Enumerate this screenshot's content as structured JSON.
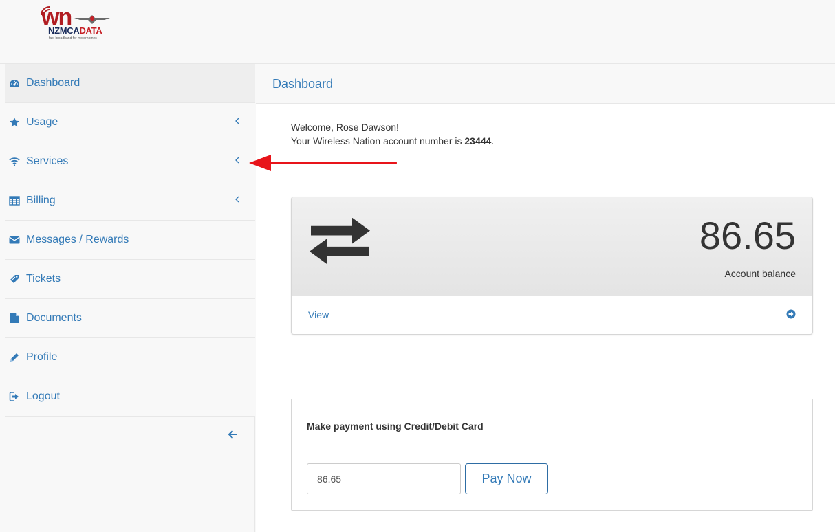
{
  "header": {
    "logo": {
      "mark": "wn",
      "brand_part1": "NZMCA",
      "brand_part2": "DATA",
      "tagline": "fast broadband for motorhomes"
    }
  },
  "sidebar": {
    "items": [
      {
        "label": "Dashboard",
        "icon": "dashboard-icon",
        "active": true,
        "has_submenu": false
      },
      {
        "label": "Usage",
        "icon": "star-icon",
        "has_submenu": true
      },
      {
        "label": "Services",
        "icon": "wifi-icon",
        "has_submenu": true
      },
      {
        "label": "Billing",
        "icon": "calculator-icon",
        "has_submenu": true
      },
      {
        "label": "Messages / Rewards",
        "icon": "envelope-icon",
        "has_submenu": false
      },
      {
        "label": "Tickets",
        "icon": "tag-icon",
        "has_submenu": false
      },
      {
        "label": "Documents",
        "icon": "file-icon",
        "has_submenu": false
      },
      {
        "label": "Profile",
        "icon": "pencil-icon",
        "has_submenu": false
      },
      {
        "label": "Logout",
        "icon": "logout-icon",
        "has_submenu": false
      }
    ],
    "collapse_icon": "arrow-left-icon"
  },
  "main": {
    "page_title": "Dashboard",
    "welcome": {
      "greeting": "Welcome, Rose Dawson!",
      "account_prefix": "Your Wireless Nation account number is ",
      "account_number": "23444",
      "account_suffix": "."
    },
    "balance_panel": {
      "icon": "exchange-icon",
      "value": "86.65",
      "label": "Account balance",
      "link_label": "View",
      "link_icon": "arrow-circle-right-icon"
    },
    "payment_panel": {
      "title": "Make payment using Credit/Debit Card",
      "amount_value": "86.65",
      "button_label": "Pay Now"
    }
  },
  "colors": {
    "link": "#337ab7",
    "annotation_arrow": "#e8141a",
    "logo_red": "#c62026",
    "logo_navy": "#1a2c5b"
  }
}
